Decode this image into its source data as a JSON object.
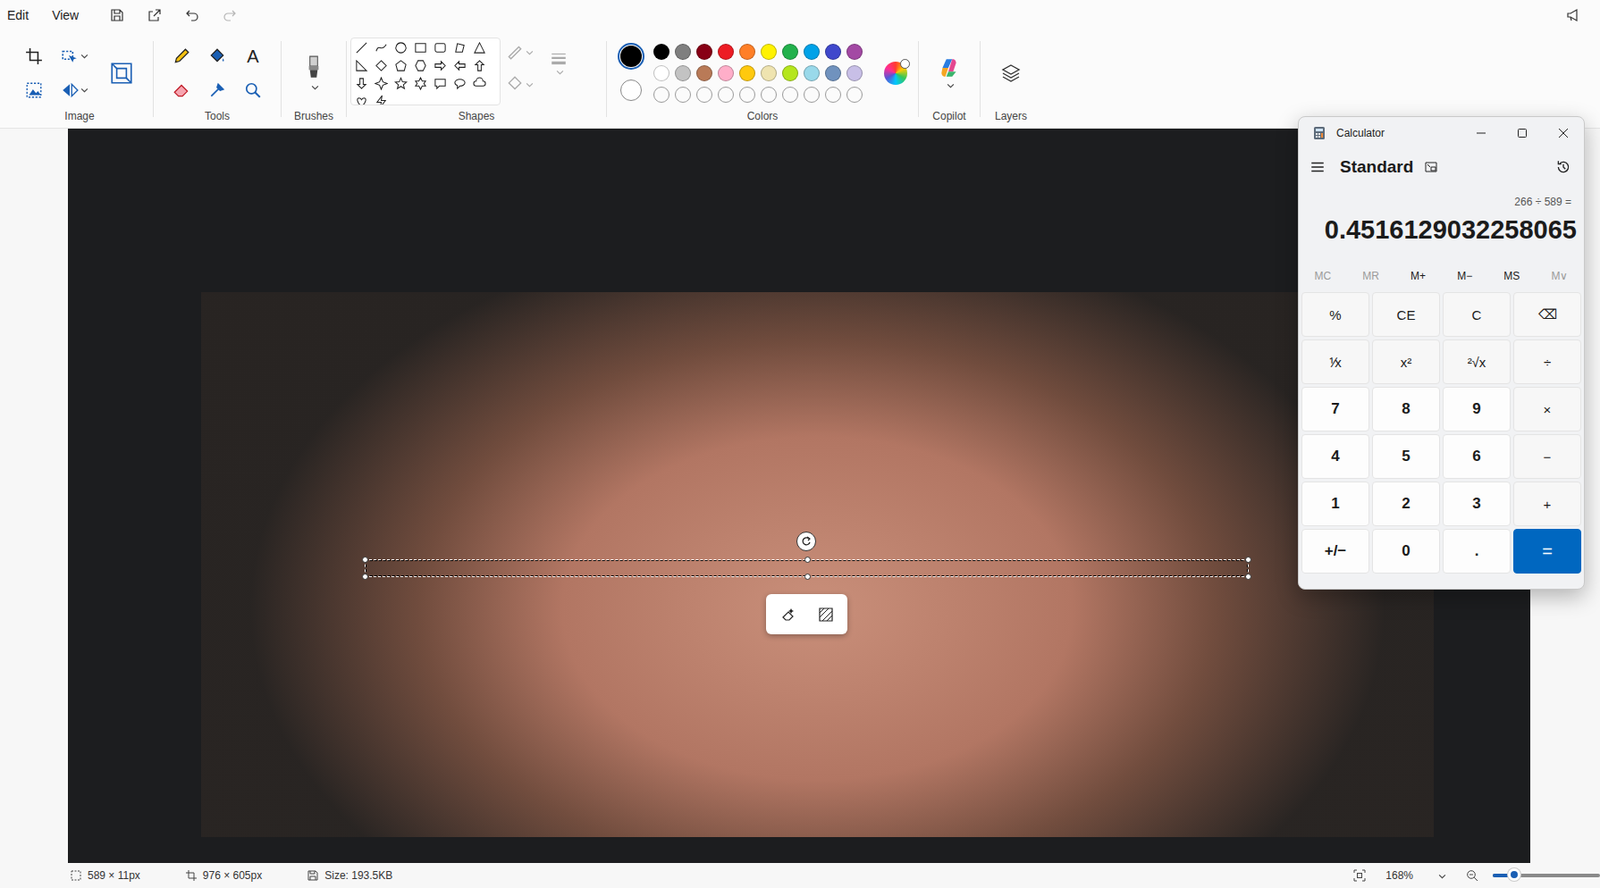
{
  "menu": [
    {
      "label": "Edit"
    },
    {
      "label": "View"
    }
  ],
  "quick_access": {
    "redo_disabled": true
  },
  "ribbon": {
    "image": "Image",
    "tools": "Tools",
    "brushes": "Brushes",
    "shapes": "Shapes",
    "colors": "Colors",
    "copilot": "Copilot",
    "layers": "Layers",
    "text_tool_icon": "A"
  },
  "colors": {
    "primary": "#000000",
    "secondary": "#ffffff",
    "primary_selected": true,
    "palette": [
      {
        "color": "#000000",
        "empty": false
      },
      {
        "color": "#7f7f7f",
        "empty": false
      },
      {
        "color": "#880015",
        "empty": false
      },
      {
        "color": "#ed1c24",
        "empty": false
      },
      {
        "color": "#ff7f27",
        "empty": false
      },
      {
        "color": "#fff200",
        "empty": false
      },
      {
        "color": "#22b14c",
        "empty": false
      },
      {
        "color": "#00a2e8",
        "empty": false
      },
      {
        "color": "#3f48cc",
        "empty": false
      },
      {
        "color": "#a349a4",
        "empty": false
      },
      {
        "color": "#ffffff",
        "empty": false
      },
      {
        "color": "#c3c3c3",
        "empty": false
      },
      {
        "color": "#b97a57",
        "empty": false
      },
      {
        "color": "#ffaec9",
        "empty": false
      },
      {
        "color": "#ffc90e",
        "empty": false
      },
      {
        "color": "#efe4b0",
        "empty": false
      },
      {
        "color": "#b5e61d",
        "empty": false
      },
      {
        "color": "#99d9ea",
        "empty": false
      },
      {
        "color": "#7092be",
        "empty": false
      },
      {
        "color": "#c8bfe7",
        "empty": false
      },
      {
        "color": "#ffffff",
        "empty": true
      },
      {
        "color": "#ffffff",
        "empty": true
      },
      {
        "color": "#ffffff",
        "empty": true
      },
      {
        "color": "#ffffff",
        "empty": true
      },
      {
        "color": "#ffffff",
        "empty": true
      },
      {
        "color": "#ffffff",
        "empty": true
      },
      {
        "color": "#ffffff",
        "empty": true
      },
      {
        "color": "#ffffff",
        "empty": true
      },
      {
        "color": "#ffffff",
        "empty": true
      },
      {
        "color": "#ffffff",
        "empty": true
      }
    ]
  },
  "calculator": {
    "title": "Calculator",
    "mode": "Standard",
    "expression": "266 ÷ 589 =",
    "display": "0.4516129032258065",
    "memory": [
      {
        "label": "MC",
        "disabled": true
      },
      {
        "label": "MR",
        "disabled": true
      },
      {
        "label": "M+",
        "disabled": false
      },
      {
        "label": "M−",
        "disabled": false
      },
      {
        "label": "MS",
        "disabled": false
      },
      {
        "label": "M∨",
        "disabled": true
      }
    ],
    "keys": [
      {
        "label": "%",
        "kind": "function"
      },
      {
        "label": "CE",
        "kind": "function"
      },
      {
        "label": "C",
        "kind": "function"
      },
      {
        "label": "⌫",
        "kind": "function"
      },
      {
        "label": "⅟x",
        "kind": "function"
      },
      {
        "label": "x²",
        "kind": "function"
      },
      {
        "label": "²√x",
        "kind": "function"
      },
      {
        "label": "÷",
        "kind": "function"
      },
      {
        "label": "7",
        "kind": "digit"
      },
      {
        "label": "8",
        "kind": "digit"
      },
      {
        "label": "9",
        "kind": "digit"
      },
      {
        "label": "×",
        "kind": "function"
      },
      {
        "label": "4",
        "kind": "digit"
      },
      {
        "label": "5",
        "kind": "digit"
      },
      {
        "label": "6",
        "kind": "digit"
      },
      {
        "label": "−",
        "kind": "function"
      },
      {
        "label": "1",
        "kind": "digit"
      },
      {
        "label": "2",
        "kind": "digit"
      },
      {
        "label": "3",
        "kind": "digit"
      },
      {
        "label": "+",
        "kind": "function"
      },
      {
        "label": "+/−",
        "kind": "digit"
      },
      {
        "label": "0",
        "kind": "digit"
      },
      {
        "label": ".",
        "kind": "digit"
      },
      {
        "label": "=",
        "kind": "equals"
      }
    ]
  },
  "status_bar": {
    "selection_size": "589 × 11px",
    "canvas_size": "976 × 605px",
    "file_size": "Size: 193.5KB",
    "zoom": "168%",
    "zoom_level": 0.2
  }
}
